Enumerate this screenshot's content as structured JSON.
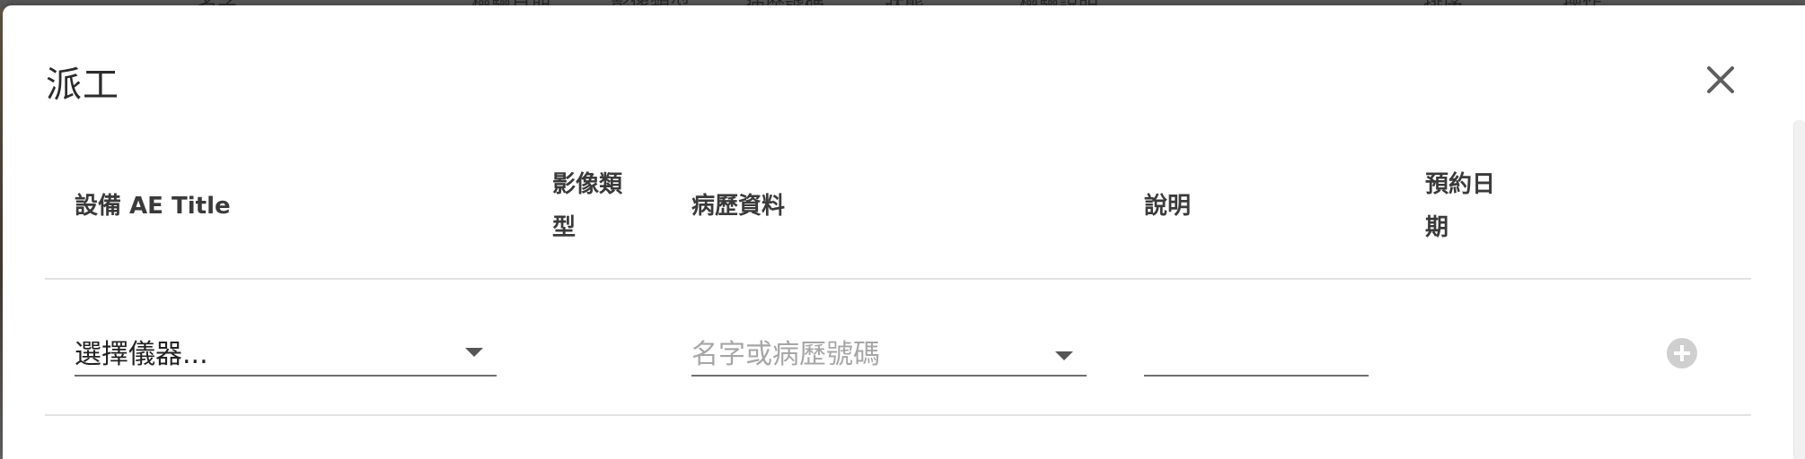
{
  "background": {
    "header_texts": [
      "名字",
      "檢驗日期",
      "影像類型",
      "病歷號碼",
      "狀態",
      "檢驗說明",
      "",
      "排序",
      "操作"
    ]
  },
  "dialog": {
    "title": "派工",
    "close_icon": "close-icon"
  },
  "table": {
    "headers": {
      "device_ae_title": "設備 AE Title",
      "modality": "影像類型",
      "medical_record": "病歷資料",
      "description": "說明",
      "appointment_date": "預約日期"
    },
    "row": {
      "device_select_value": "選擇儀器...",
      "patient_select_placeholder": "名字或病歷號碼",
      "description_value": "",
      "add_icon": "plus-circle-icon"
    }
  },
  "colors": {
    "overlay": "#6b6b6b",
    "dialog_bg": "#ffffff",
    "divider": "#e2e2e2",
    "add_button": "#cfcfcf"
  }
}
